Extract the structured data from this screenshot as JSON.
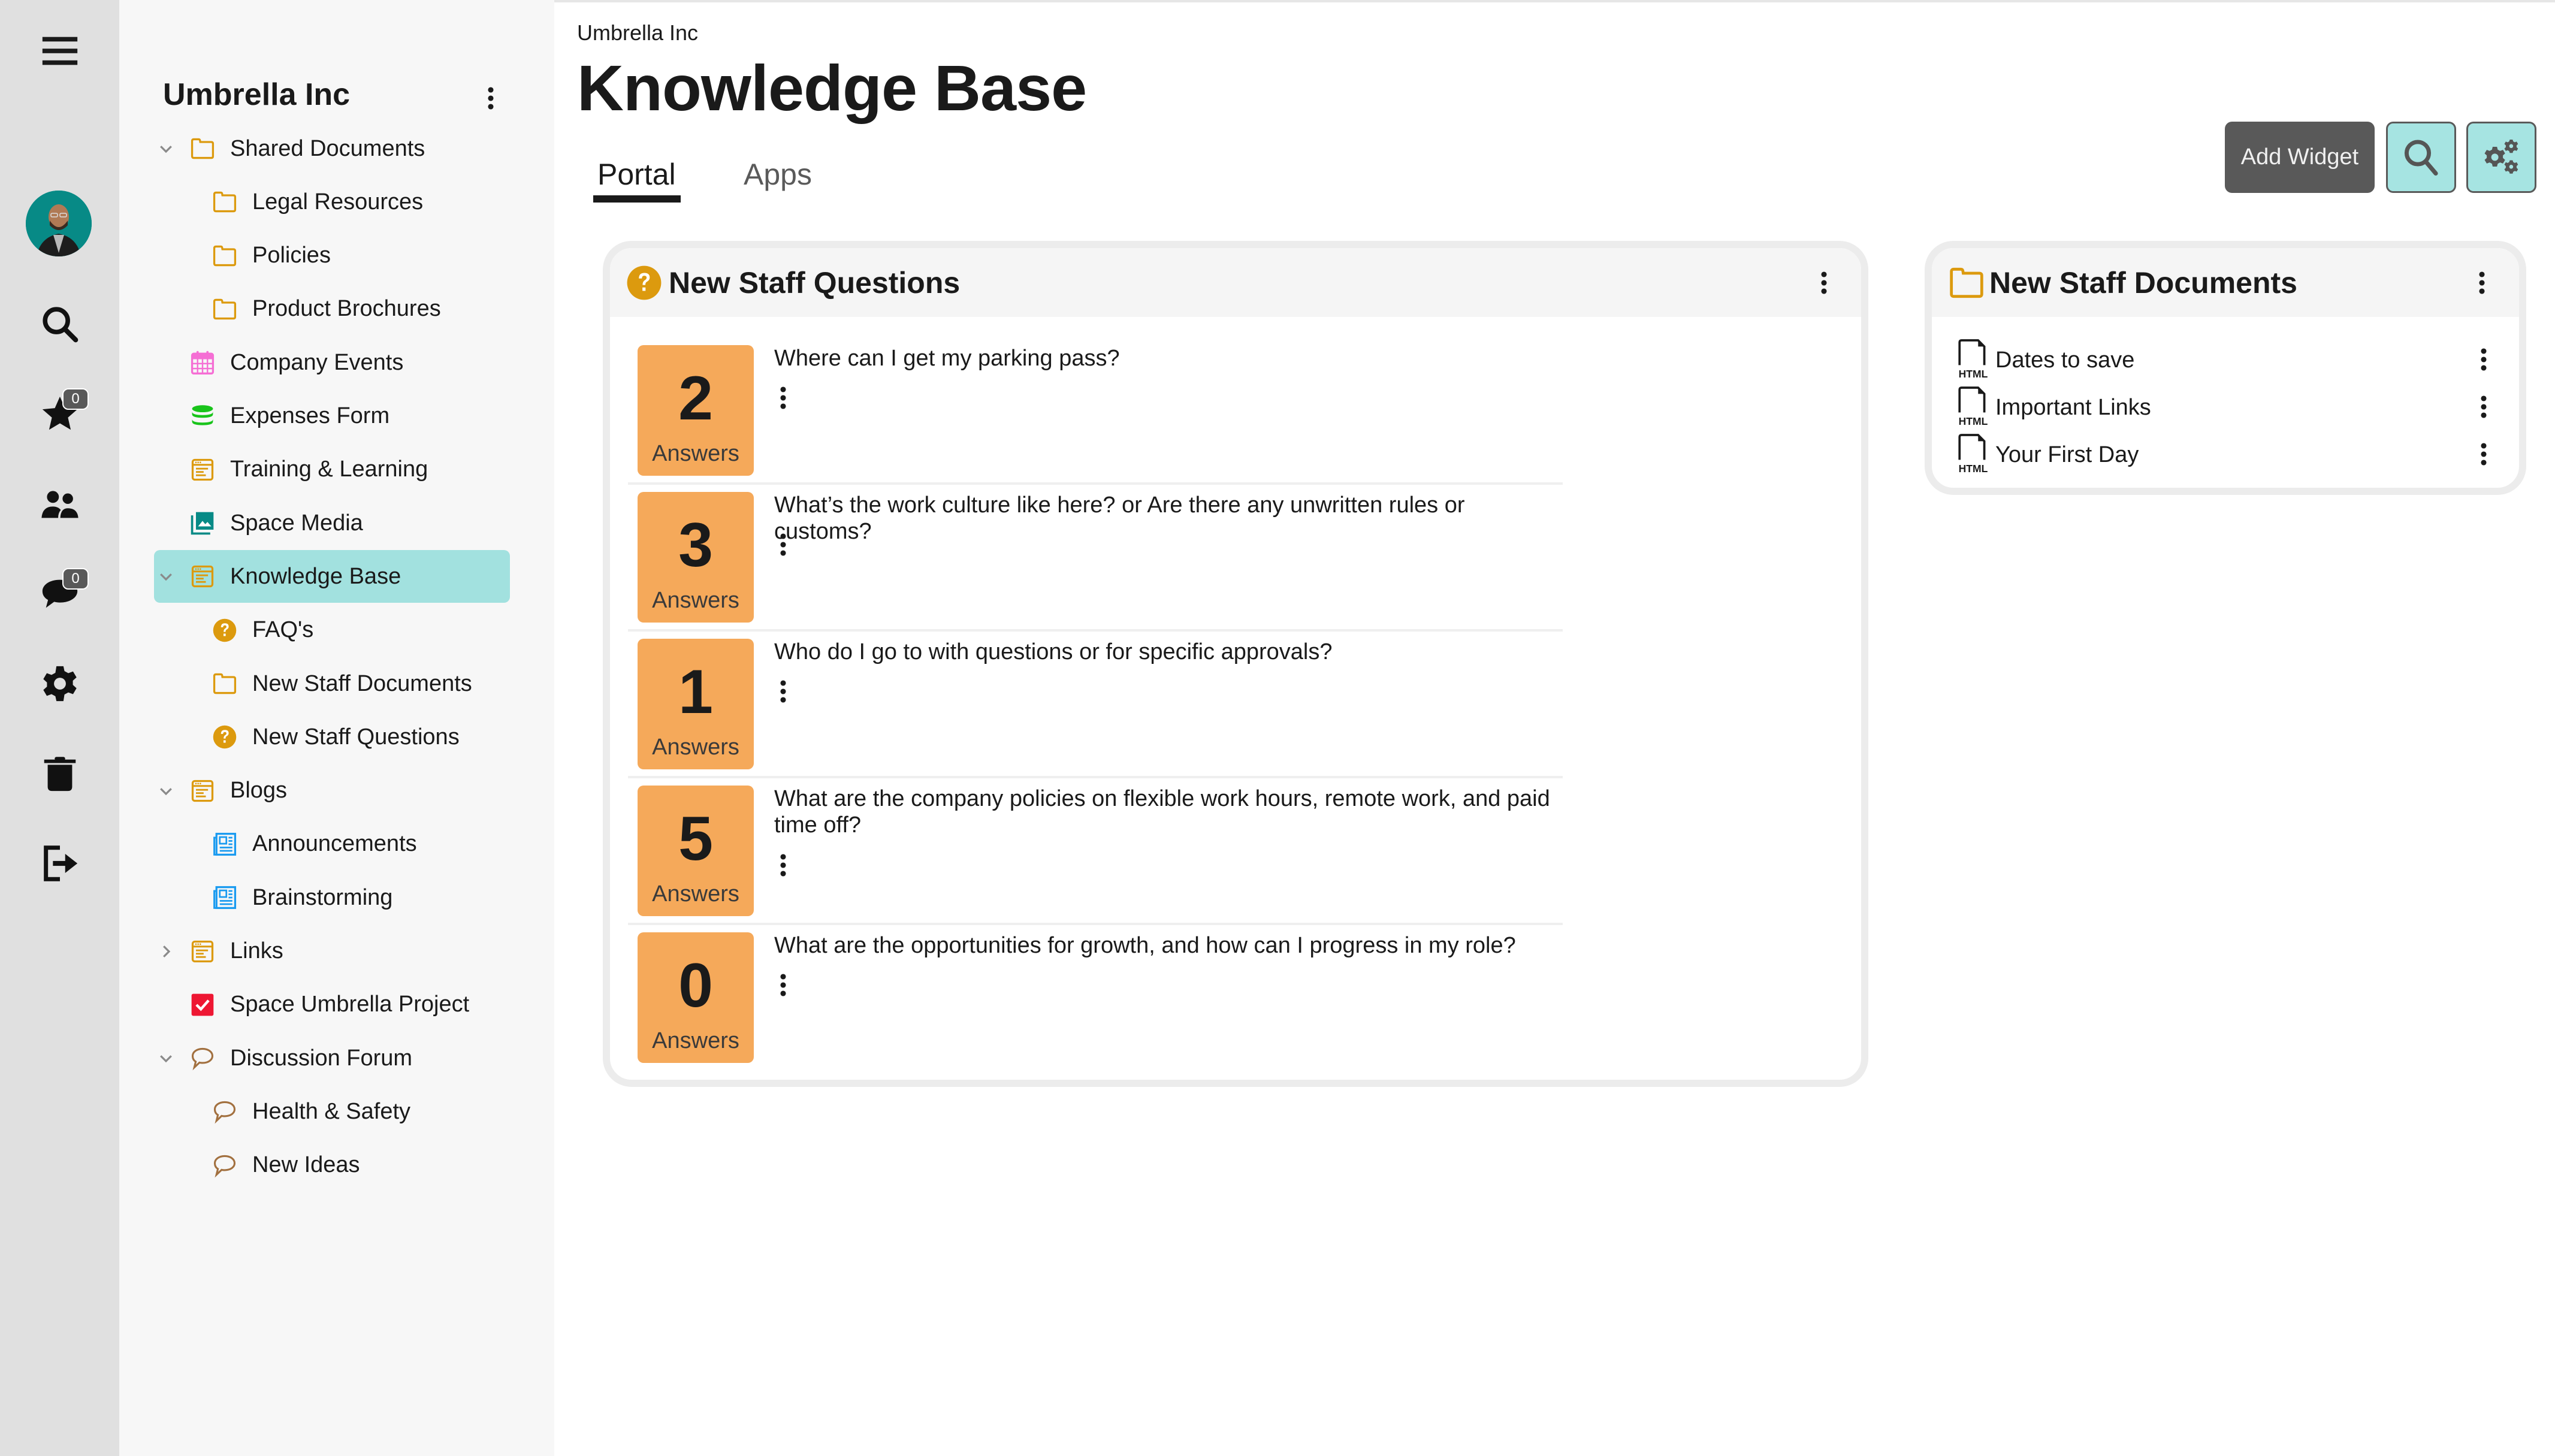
{
  "rail": {
    "menu_icon": "hamburger-icon",
    "items": [
      {
        "name": "search",
        "icon": "search-icon"
      },
      {
        "name": "favorites",
        "icon": "star-icon",
        "badge": "0"
      },
      {
        "name": "people",
        "icon": "users-icon"
      },
      {
        "name": "messages",
        "icon": "chat-icon",
        "badge": "0"
      },
      {
        "name": "settings",
        "icon": "gear-icon"
      },
      {
        "name": "trash",
        "icon": "trash-icon"
      },
      {
        "name": "logout",
        "icon": "logout-icon"
      }
    ]
  },
  "tree": {
    "title": "Umbrella Inc",
    "nodes": [
      {
        "label": "Shared Documents",
        "icon": "folder-icon",
        "level": 0,
        "expander": "expanded"
      },
      {
        "label": "Legal Resources",
        "icon": "folder-icon",
        "level": 1
      },
      {
        "label": "Policies",
        "icon": "folder-icon",
        "level": 1
      },
      {
        "label": "Product Brochures",
        "icon": "folder-icon",
        "level": 1
      },
      {
        "label": "Company Events",
        "icon": "calendar-icon",
        "level": 0
      },
      {
        "label": "Expenses Form",
        "icon": "database-icon",
        "level": 0
      },
      {
        "label": "Training & Learning",
        "icon": "wiki-icon",
        "level": 0
      },
      {
        "label": "Space Media",
        "icon": "media-icon",
        "level": 0
      },
      {
        "label": "Knowledge Base",
        "icon": "wiki-icon",
        "level": 0,
        "expander": "expanded",
        "selected": true
      },
      {
        "label": "FAQ's",
        "icon": "question-icon",
        "level": 1
      },
      {
        "label": "New Staff Documents",
        "icon": "folder-icon",
        "level": 1
      },
      {
        "label": "New Staff Questions",
        "icon": "question-icon",
        "level": 1
      },
      {
        "label": "Blogs",
        "icon": "wiki-icon",
        "level": 0,
        "expander": "expanded"
      },
      {
        "label": "Announcements",
        "icon": "newspaper-icon",
        "level": 1
      },
      {
        "label": "Brainstorming",
        "icon": "newspaper-icon",
        "level": 1
      },
      {
        "label": "Links",
        "icon": "wiki-icon",
        "level": 0,
        "expander": "collapsed"
      },
      {
        "label": "Space Umbrella Project",
        "icon": "task-icon",
        "level": 0
      },
      {
        "label": "Discussion Forum",
        "icon": "forum-icon",
        "level": 0,
        "expander": "expanded"
      },
      {
        "label": "Health & Safety",
        "icon": "forum-icon",
        "level": 1
      },
      {
        "label": "New Ideas",
        "icon": "forum-icon",
        "level": 1
      }
    ]
  },
  "header": {
    "breadcrumb": "Umbrella Inc",
    "title": "Knowledge Base",
    "tabs": [
      {
        "label": "Portal",
        "active": true
      },
      {
        "label": "Apps",
        "active": false
      }
    ],
    "add_widget_label": "Add Widget"
  },
  "questions_widget": {
    "title": "New Staff Questions",
    "answers_label": "Answers",
    "items": [
      {
        "count": "2",
        "question": "Where can I get my parking pass?"
      },
      {
        "count": "3",
        "question": "What’s the work culture like here? or Are there any unwritten rules or customs?"
      },
      {
        "count": "1",
        "question": "Who do I go to with questions or for specific approvals?"
      },
      {
        "count": "5",
        "question": "What are the company policies on flexible work hours, remote work, and paid time off?"
      },
      {
        "count": "0",
        "question": "What are the opportunities for growth, and how can I progress in my role?"
      }
    ]
  },
  "documents_widget": {
    "title": "New Staff Documents",
    "file_type_label": "HTML",
    "items": [
      {
        "name": "Dates to save"
      },
      {
        "name": "Important Links"
      },
      {
        "name": "Your First Day"
      }
    ]
  },
  "colors": {
    "accent_teal": "#a2e1df",
    "answers_orange": "#f5a95a",
    "folder_gold": "#dc9a0e",
    "rail_bg": "#e0e0e0",
    "button_dark": "#595959"
  }
}
